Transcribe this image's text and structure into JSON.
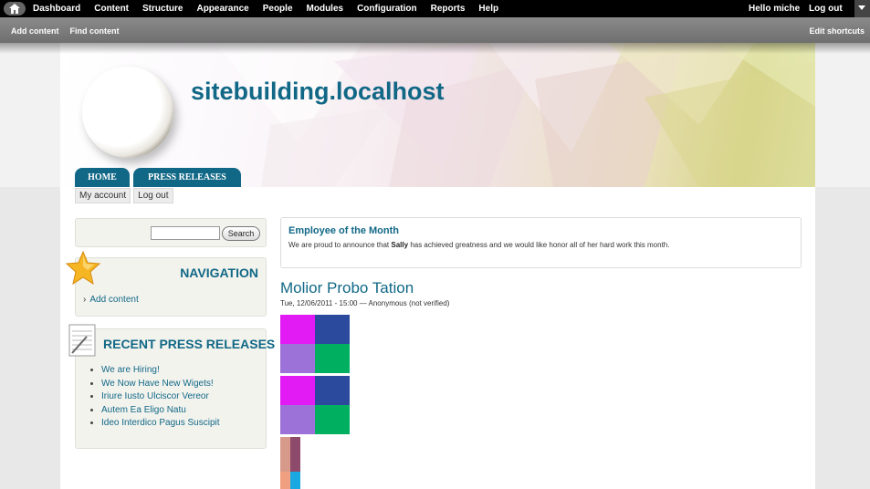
{
  "toolbar": {
    "menu": [
      "Dashboard",
      "Content",
      "Structure",
      "Appearance",
      "People",
      "Modules",
      "Configuration",
      "Reports",
      "Help"
    ],
    "hello": "Hello",
    "username": "miche",
    "logout": "Log out"
  },
  "shortcuts": {
    "add_content": "Add content",
    "find_content": "Find content",
    "edit_shortcuts": "Edit shortcuts"
  },
  "header": {
    "site_name": "sitebuilding.localhost",
    "tabs": [
      "HOME",
      "PRESS RELEASES"
    ]
  },
  "secondary_links": [
    "My account",
    "Log out"
  ],
  "search": {
    "value": "",
    "button": "Search"
  },
  "navigation": {
    "title": "NAVIGATION",
    "items": [
      "Add content"
    ]
  },
  "press_releases": {
    "title": "RECENT PRESS RELEASES",
    "items": [
      "We are Hiring!",
      "We Now Have New Wigets!",
      "Iriure Iusto Ulciscor Vereor",
      "Autem Ea Eligo Natu",
      "Ideo Interdico Pagus Suscipit"
    ]
  },
  "employee_of_month": {
    "title": "Employee of the Month",
    "text_before": "We are proud to announce that",
    "name": "Sally",
    "text_after": "has achieved greatness and we would like honor all of her hard work this month."
  },
  "node": {
    "title": "Molior Probo Tation",
    "meta": "Tue, 12/06/2011 - 15:00 — Anonymous (not verified)"
  },
  "colors": {
    "brand": "#116886",
    "swatch_magenta": "#e21bf5",
    "swatch_navy": "#2b4a9e",
    "swatch_lavender": "#9d72d8",
    "swatch_green": "#00b060"
  }
}
